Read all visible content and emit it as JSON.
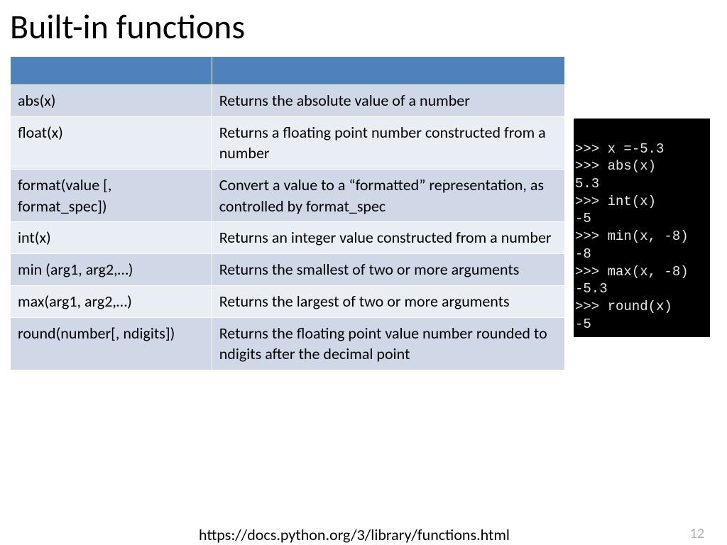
{
  "title": "Built-in functions",
  "table": {
    "rows": [
      {
        "fn": "abs(x)",
        "desc": "Returns the absolute value of a number"
      },
      {
        "fn": "float(x)",
        "desc": "Returns a floating point number constructed from a number"
      },
      {
        "fn": "format(value [, format_spec])",
        "desc": "Convert a value to a “formatted” representation, as controlled by format_spec"
      },
      {
        "fn": "int(x)",
        "desc": "Returns an integer value constructed from a number"
      },
      {
        "fn": "min (arg1, arg2,…)",
        "desc": "Returns the smallest of two or more arguments"
      },
      {
        "fn": "max(arg1, arg2,…)",
        "desc": "Returns the largest of two or more arguments"
      },
      {
        "fn": "round(number[, ndigits])",
        "desc": "Returns the floating point value number rounded to ndigits after the decimal point"
      }
    ]
  },
  "terminal_lines": [
    ">>> x =-5.3",
    ">>> abs(x)",
    "5.3",
    ">>> int(x)",
    "-5",
    ">>> min(x, -8)",
    "-8",
    ">>> max(x, -8)",
    "-5.3",
    ">>> round(x)",
    "-5"
  ],
  "footer": {
    "link": "https://docs.python.org/3/library/functions.html",
    "page": "12"
  }
}
